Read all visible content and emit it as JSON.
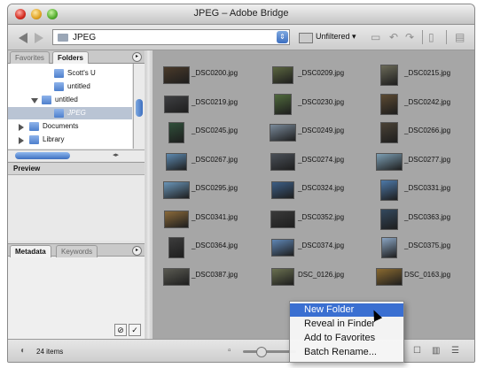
{
  "window": {
    "title": "JPEG – Adobe Bridge"
  },
  "toolbar": {
    "path": "JPEG",
    "filter": "Unfiltered",
    "filter_caret": "▾"
  },
  "left_panel": {
    "tabs": [
      "Favorites",
      "Folders"
    ],
    "tree": [
      {
        "label": "Scott's U",
        "indent": 3,
        "expander": "none",
        "selected": false
      },
      {
        "label": "untitled",
        "indent": 3,
        "expander": "none",
        "selected": false
      },
      {
        "label": "untitled",
        "indent": 2,
        "expander": "down",
        "selected": false
      },
      {
        "label": "JPEG",
        "indent": 3,
        "expander": "none",
        "selected": true
      },
      {
        "label": "Documents",
        "indent": 1,
        "expander": "right",
        "selected": false
      },
      {
        "label": "Library",
        "indent": 1,
        "expander": "right",
        "selected": false
      }
    ],
    "preview_tab": "Preview",
    "meta_tabs": [
      "Metadata",
      "Keywords"
    ]
  },
  "thumbnails": [
    {
      "name": "_DSC0200.jpg",
      "color": "#4a3a2a"
    },
    {
      "name": "_DSC0209.jpg",
      "color": "#5b6640"
    },
    {
      "name": "_DSC0215.jpg",
      "color": "#6b6a58"
    },
    {
      "name": "_DSC0219.jpg",
      "color": "#3e3f42"
    },
    {
      "name": "_DSC0230.jpg",
      "color": "#4f6a3c"
    },
    {
      "name": "_DSC0242.jpg",
      "color": "#5c4a32"
    },
    {
      "name": "_DSC0245.jpg",
      "color": "#2f4f3a"
    },
    {
      "name": "_DSC0249.jpg",
      "color": "#7a8a9a"
    },
    {
      "name": "_DSC0266.jpg",
      "color": "#4a4236"
    },
    {
      "name": "_DSC0267.jpg",
      "color": "#5e8ab0"
    },
    {
      "name": "_DSC0274.jpg",
      "color": "#4a5058"
    },
    {
      "name": "_DSC0277.jpg",
      "color": "#7d9fb4"
    },
    {
      "name": "_DSC0295.jpg",
      "color": "#6a95b8"
    },
    {
      "name": "_DSC0324.jpg",
      "color": "#3d5f86"
    },
    {
      "name": "_DSC0331.jpg",
      "color": "#4d79a8"
    },
    {
      "name": "_DSC0341.jpg",
      "color": "#8a6a3a"
    },
    {
      "name": "_DSC0352.jpg",
      "color": "#3a3a3a"
    },
    {
      "name": "_DSC0363.jpg",
      "color": "#34495e"
    },
    {
      "name": "_DSC0364.jpg",
      "color": "#3c3c3c"
    },
    {
      "name": "_DSC0374.jpg",
      "color": "#5f86b4"
    },
    {
      "name": "_DSC0375.jpg",
      "color": "#8aa4c2"
    },
    {
      "name": "_DSC0387.jpg",
      "color": "#5a5a52"
    },
    {
      "name": "DSC_0126.jpg",
      "color": "#6a7050"
    },
    {
      "name": "DSC_0163.jpg",
      "color": "#8a6a30"
    }
  ],
  "status": {
    "item_count": "24 items"
  },
  "context_menu": {
    "items": [
      "New Folder",
      "Reveal in Finder",
      "Add to Favorites",
      "Batch Rename..."
    ],
    "highlighted_index": 0
  },
  "colors": {
    "accent": "#3a6fd1",
    "content_bg": "#a6a6a6"
  }
}
